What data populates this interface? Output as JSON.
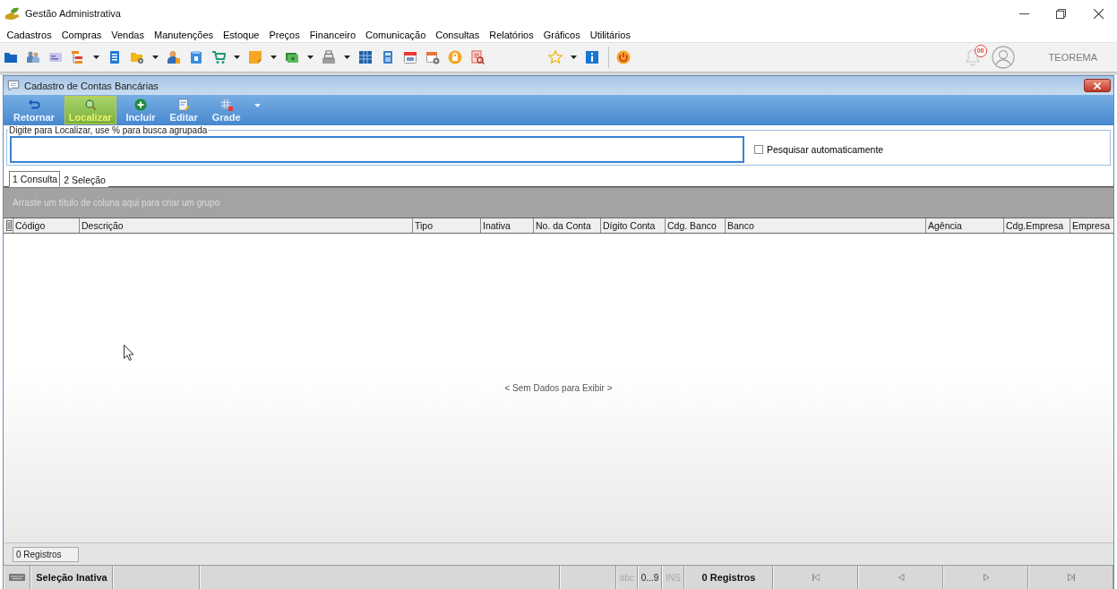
{
  "window": {
    "title": "Gestão Administrativa"
  },
  "menu": [
    "Cadastros",
    "Compras",
    "Vendas",
    "Manutenções",
    "Estoque",
    "Preços",
    "Financeiro",
    "Comunicação",
    "Consultas",
    "Relatórios",
    "Gráficos",
    "Utilitários"
  ],
  "toolbar": {
    "notification_badge": "00",
    "user": "TEOREMA"
  },
  "form": {
    "title": "Cadastro de Contas Bancárias",
    "actions": [
      {
        "label": "Retornar",
        "selected": false
      },
      {
        "label": "Localizar",
        "selected": true
      },
      {
        "label": "Incluir",
        "selected": false
      },
      {
        "label": "Editar",
        "selected": false
      },
      {
        "label": "Grade",
        "selected": false
      }
    ],
    "search": {
      "legend": "Digite para Localizar, use % para busca agrupada",
      "auto_search": {
        "label": "Pesquisar automaticamente",
        "checked": false
      }
    },
    "tabs": [
      {
        "label": "1 Consulta",
        "selected": true
      },
      {
        "label": "2 Seleção",
        "selected": false
      }
    ],
    "group_panel": "Arraste um título de coluna aqui para criar um grupo",
    "table": {
      "columns": [
        "Código",
        "Descrição",
        "Tipo",
        "Inativa",
        "No. da Conta",
        "Dígito Conta",
        "Cdg. Banco",
        "Banco",
        "Agência",
        "Cdg.Empresa",
        "Empresa"
      ],
      "empty_text": "< Sem Dados para Exibir >",
      "footer": "0 Registros"
    }
  },
  "status_bar": {
    "mode": "Seleção Inativa",
    "indicators": [
      {
        "label": "abc",
        "on": false
      },
      {
        "label": "0...9",
        "on": true
      },
      {
        "label": "INS",
        "on": false
      }
    ],
    "records": "0 Registros"
  }
}
